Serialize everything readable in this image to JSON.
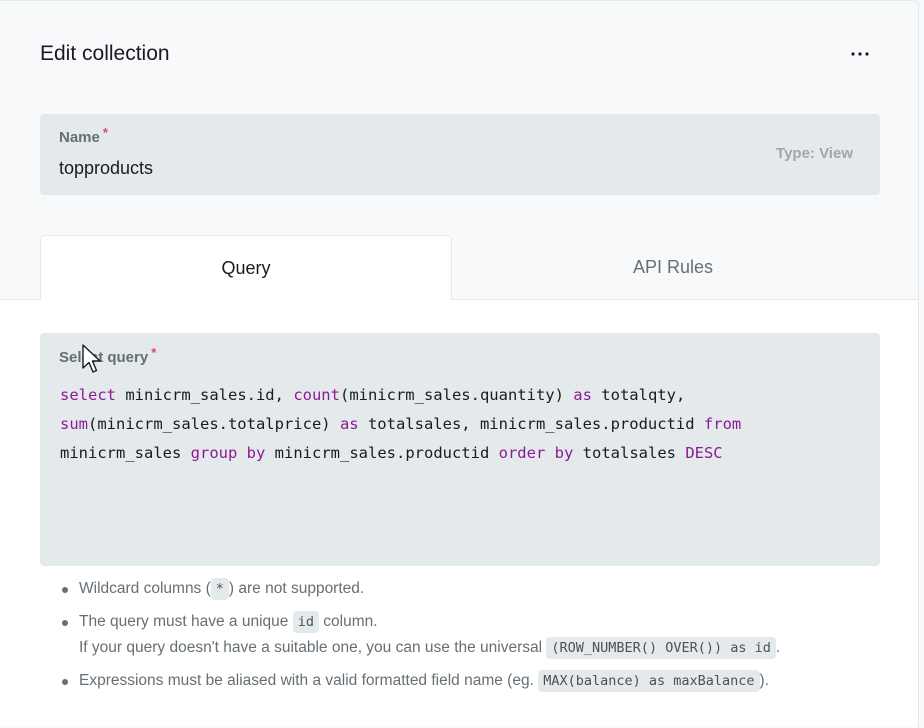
{
  "header": {
    "title": "Edit collection",
    "more_icon": "ellipsis-icon"
  },
  "name_field": {
    "label": "Name",
    "required_mark": "*",
    "value": "topproducts",
    "type_hint": "Type: View"
  },
  "tabs": [
    {
      "label": "Query",
      "active": true
    },
    {
      "label": "API Rules",
      "active": false
    }
  ],
  "query_field": {
    "label": "Select query",
    "required_mark": "*",
    "lines": [
      [
        {
          "t": "select",
          "kw": true
        },
        {
          "t": " minicrm_sales.id, "
        },
        {
          "t": "count",
          "kw": true
        },
        {
          "t": "(minicrm_sales.quantity) "
        },
        {
          "t": "as",
          "kw": true
        },
        {
          "t": " totalqty,"
        }
      ],
      [
        {
          "t": "sum",
          "kw": true
        },
        {
          "t": "(minicrm_sales.totalprice) "
        },
        {
          "t": "as",
          "kw": true
        },
        {
          "t": " totalsales, minicrm_sales.productid "
        },
        {
          "t": "from",
          "kw": true
        }
      ],
      [
        {
          "t": "minicrm_sales "
        },
        {
          "t": "group",
          "kw": true
        },
        {
          "t": " "
        },
        {
          "t": "by",
          "kw": true
        },
        {
          "t": " minicrm_sales.productid "
        },
        {
          "t": "order",
          "kw": true
        },
        {
          "t": " "
        },
        {
          "t": "by",
          "kw": true
        },
        {
          "t": " totalsales "
        },
        {
          "t": "DESC",
          "kw": true
        }
      ]
    ]
  },
  "notes": {
    "n1_pre": "Wildcard columns (",
    "n1_code": "*",
    "n1_post": ") are not supported.",
    "n2_pre": "The query must have a unique ",
    "n2_code": "id",
    "n2_post": " column.",
    "n2_line2_pre": "If your query doesn't have a suitable one, you can use the universal ",
    "n2_line2_code": "(ROW_NUMBER() OVER()) as id",
    "n2_line2_post": ".",
    "n3_pre": "Expressions must be aliased with a valid formatted field name (eg. ",
    "n3_code": "MAX(balance) as maxBalance",
    "n3_post": ")."
  },
  "colors": {
    "keyword": "#8d1a91",
    "required": "#e34562",
    "field_bg": "#e4e9ec"
  },
  "mouse_cursor_icon": "arrow-cursor-icon"
}
